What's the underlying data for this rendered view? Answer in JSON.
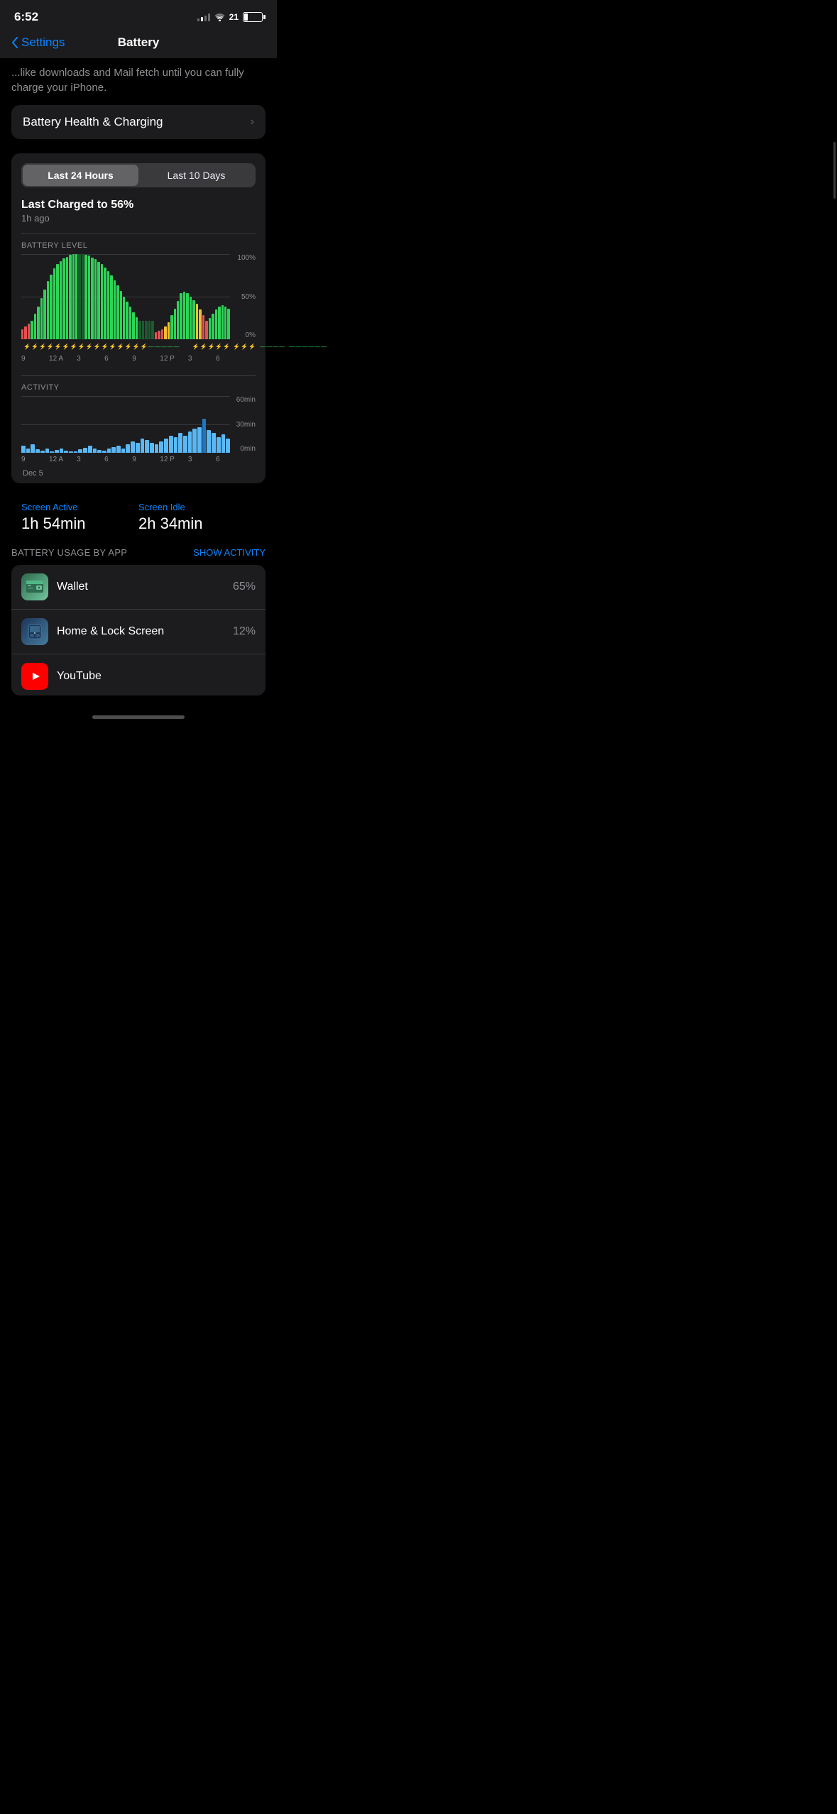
{
  "statusBar": {
    "time": "6:52",
    "battery": "21",
    "signal": [
      1,
      2,
      3,
      4
    ],
    "signalActive": 1
  },
  "nav": {
    "backLabel": "Settings",
    "title": "Battery"
  },
  "truncatedText": "...like downloads and Mail fetch until you can fully charge your iPhone.",
  "batteryHealth": {
    "label": "Battery Health & Charging",
    "chevron": "›"
  },
  "tabs": {
    "active": 0,
    "items": [
      "Last 24 Hours",
      "Last 10 Days"
    ]
  },
  "lastCharged": {
    "title": "Last Charged to 56%",
    "subtitle": "1h ago"
  },
  "batteryChart": {
    "label": "BATTERY LEVEL",
    "yLabels": [
      "100%",
      "50%",
      "0%"
    ],
    "xLabels": [
      "9",
      "12 A",
      "3",
      "6",
      "9",
      "12 P",
      "3",
      "6"
    ]
  },
  "activityChart": {
    "label": "ACTIVITY",
    "yLabels": [
      "60min",
      "30min",
      "0min"
    ],
    "xLabels": [
      "9",
      "12 A",
      "3",
      "6",
      "9",
      "12 P",
      "3",
      "6"
    ],
    "dateLabel": "Dec 5"
  },
  "screenStats": [
    {
      "label": "Screen Active",
      "value": "1h 54min"
    },
    {
      "label": "Screen Idle",
      "value": "2h 34min"
    }
  ],
  "usageSection": {
    "label": "BATTERY USAGE BY APP",
    "showActivityLabel": "SHOW ACTIVITY"
  },
  "apps": [
    {
      "name": "Wallet",
      "pct": "65%",
      "icon": "wallet"
    },
    {
      "name": "Home & Lock Screen",
      "pct": "12%",
      "icon": "homescreen"
    },
    {
      "name": "YouTube",
      "pct": "",
      "icon": "youtube"
    }
  ]
}
